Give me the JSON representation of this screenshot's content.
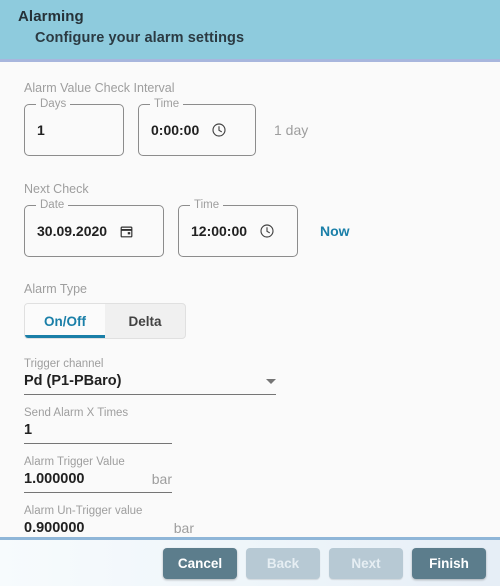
{
  "header": {
    "title": "Alarming",
    "subtitle": "Configure your alarm settings"
  },
  "colors": {
    "header_bg": "#8ecbdd",
    "accent": "#1a7fa8",
    "button_enabled": "#5c7d8c",
    "button_disabled": "#b7c9d4"
  },
  "interval_section": {
    "label": "Alarm Value Check Interval",
    "days": {
      "label": "Days",
      "value": "1"
    },
    "time": {
      "label": "Time",
      "value": "0:00:00",
      "icon": "clock-icon"
    },
    "summary": "1 day"
  },
  "next_check_section": {
    "label": "Next Check",
    "date": {
      "label": "Date",
      "value": "30.09.2020",
      "icon": "calendar-icon"
    },
    "time": {
      "label": "Time",
      "value": "12:00:00",
      "icon": "clock-icon"
    },
    "now_link": "Now"
  },
  "alarm_type_section": {
    "label": "Alarm Type",
    "tabs": [
      {
        "label": "On/Off",
        "active": true
      },
      {
        "label": "Delta",
        "active": false
      }
    ]
  },
  "fields": {
    "trigger_channel": {
      "label": "Trigger channel",
      "value": "Pd (P1-PBaro)",
      "icon": "chevron-down-icon"
    },
    "send_alarm_x_times": {
      "label": "Send Alarm X Times",
      "value": "1"
    },
    "alarm_trigger_value": {
      "label": "Alarm Trigger Value",
      "value": "1.000000",
      "unit": "bar"
    },
    "alarm_untrigger_value": {
      "label": "Alarm Un-Trigger value",
      "value": "0.900000",
      "unit": "bar"
    }
  },
  "footer": {
    "buttons": [
      {
        "label": "Cancel",
        "enabled": true
      },
      {
        "label": "Back",
        "enabled": false
      },
      {
        "label": "Next",
        "enabled": false
      },
      {
        "label": "Finish",
        "enabled": true
      }
    ]
  }
}
